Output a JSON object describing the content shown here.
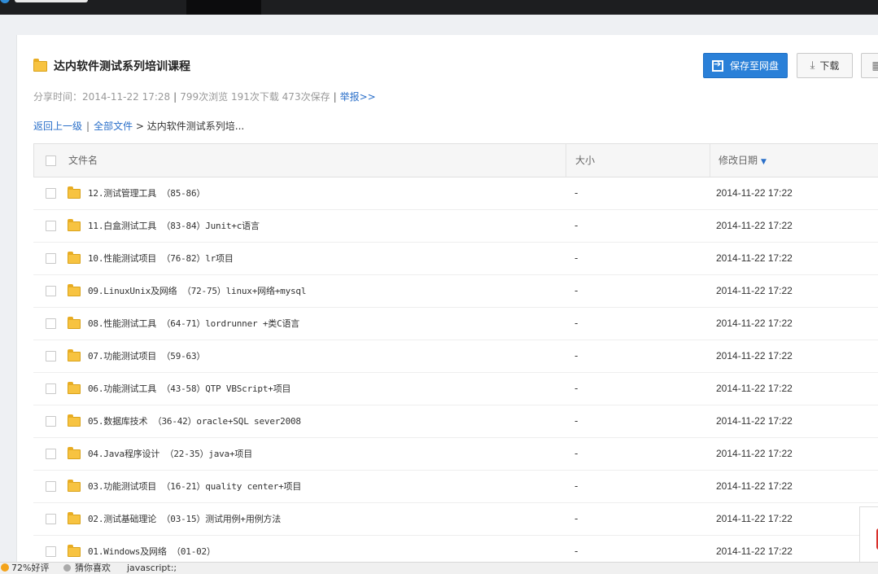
{
  "share": {
    "title": "达内软件测试系列培训课程",
    "meta": {
      "share_time_label": "分享时间：",
      "share_time": "2014-11-22 17:28",
      "views": "799次浏览",
      "downloads": "191次下载",
      "saves": "473次保存",
      "report": "举报>>"
    },
    "buttons": {
      "save": "保存至网盘",
      "download": "下载"
    }
  },
  "breadcrumb": {
    "back": "返回上一级",
    "all_files": "全部文件",
    "separator": ">",
    "current": "达内软件测试系列培..."
  },
  "table": {
    "columns": {
      "name": "文件名",
      "size": "大小",
      "modified": "修改日期"
    },
    "rows": [
      {
        "name": "12.测试管理工具 （85-86）",
        "size": "-",
        "modified": "2014-11-22 17:22"
      },
      {
        "name": "11.白盒测试工具 （83-84）Junit+c语言",
        "size": "-",
        "modified": "2014-11-22 17:22"
      },
      {
        "name": "10.性能测试项目 （76-82）lr项目",
        "size": "-",
        "modified": "2014-11-22 17:22"
      },
      {
        "name": "09.LinuxUnix及网络 （72-75）linux+网络+mysql",
        "size": "-",
        "modified": "2014-11-22 17:22"
      },
      {
        "name": "08.性能测试工具 （64-71）lordrunner +类C语言",
        "size": "-",
        "modified": "2014-11-22 17:22"
      },
      {
        "name": "07.功能测试项目 （59-63）",
        "size": "-",
        "modified": "2014-11-22 17:22"
      },
      {
        "name": "06.功能测试工具 （43-58）QTP VBScript+项目",
        "size": "-",
        "modified": "2014-11-22 17:22"
      },
      {
        "name": "05.数据库技术 （36-42）oracle+SQL sever2008",
        "size": "-",
        "modified": "2014-11-22 17:22"
      },
      {
        "name": "04.Java程序设计 （22-35）java+项目",
        "size": "-",
        "modified": "2014-11-22 17:22"
      },
      {
        "name": "03.功能测试项目 （16-21）quality center+项目",
        "size": "-",
        "modified": "2014-11-22 17:22"
      },
      {
        "name": "02.测试基础理论 （03-15）测试用例+用例方法",
        "size": "-",
        "modified": "2014-11-22 17:22"
      },
      {
        "name": "01.Windows及网络 （01-02）",
        "size": "-",
        "modified": "2014-11-22 17:22"
      }
    ]
  },
  "statusbar": {
    "rating": "72%好评",
    "guess": "猜你喜欢",
    "script": "javascript:;"
  },
  "colors": {
    "accent": "#2a80d8",
    "link": "#2a6fc9",
    "folder": "#f7c341",
    "topbar": "#1d1e20"
  },
  "icons": [
    "folder-icon",
    "save-to-disk-icon",
    "download-icon",
    "qrcode-icon",
    "sort-down-icon",
    "checkbox-icon"
  ]
}
